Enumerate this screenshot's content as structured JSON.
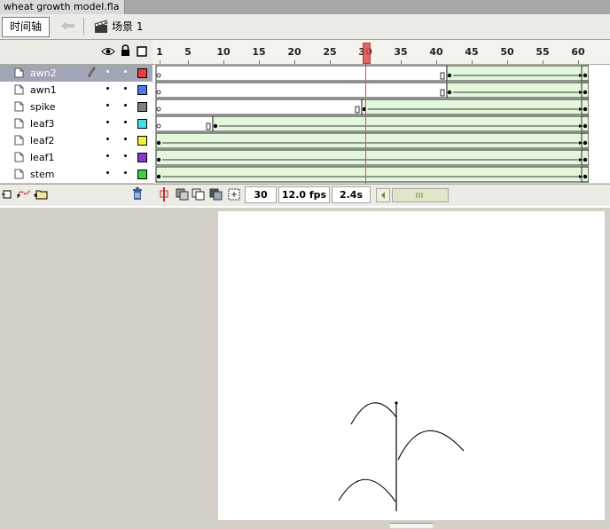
{
  "document": {
    "tab_title": "wheat growth model.fla"
  },
  "toolbar": {
    "timeline_label": "时间轴",
    "scene_label": "场景 1"
  },
  "ruler": {
    "labels": [
      "1",
      "5",
      "10",
      "15",
      "20",
      "25",
      "30",
      "35",
      "40",
      "45",
      "50",
      "55",
      "60"
    ],
    "frames": [
      1,
      5,
      10,
      15,
      20,
      25,
      30,
      35,
      40,
      45,
      50,
      55,
      60
    ],
    "total_frames": 61
  },
  "playhead": {
    "frame": 30
  },
  "layers": [
    {
      "name": "awn2",
      "color": "#e84040",
      "selected": true,
      "keyframes": [
        1,
        41,
        42,
        61
      ],
      "tween_start": 42,
      "tween_end": 61
    },
    {
      "name": "awn1",
      "color": "#4a7ae8",
      "selected": false,
      "keyframes": [
        1,
        41,
        42,
        61
      ],
      "tween_start": 42,
      "tween_end": 61
    },
    {
      "name": "spike",
      "color": "#808080",
      "selected": false,
      "keyframes": [
        1,
        29,
        30,
        61
      ],
      "tween_start": 30,
      "tween_end": 61
    },
    {
      "name": "leaf3",
      "color": "#48e0e8",
      "selected": false,
      "keyframes": [
        1,
        8,
        9,
        61
      ],
      "tween_start": 9,
      "tween_end": 61
    },
    {
      "name": "leaf2",
      "color": "#f0f040",
      "selected": false,
      "keyframes": [
        1,
        61
      ],
      "tween_start": 1,
      "tween_end": 61
    },
    {
      "name": "leaf1",
      "color": "#8a3ad0",
      "selected": false,
      "keyframes": [
        1,
        61
      ],
      "tween_start": 1,
      "tween_end": 61
    },
    {
      "name": "stem",
      "color": "#40d040",
      "selected": false,
      "keyframes": [
        1,
        61
      ],
      "tween_start": 1,
      "tween_end": 61
    }
  ],
  "status": {
    "current_frame": "30",
    "frame_rate": "12.0 fps",
    "elapsed_time": "2.4s"
  },
  "icons": {
    "layer": "layer-page-icon",
    "pencil": "pencil-icon",
    "eye": "eye-icon",
    "lock": "lock-icon",
    "outline": "outline-square-icon",
    "insert_layer": "insert-layer-icon",
    "motion_guide": "add-motion-guide-icon",
    "folder": "insert-folder-icon",
    "trash": "delete-layer-icon",
    "center_frame": "center-frame-icon",
    "onion": "onion-skin-icon",
    "onion_outline": "onion-skin-outline-icon",
    "edit_multiple": "edit-multiple-frames-icon",
    "onion_markers": "modify-onion-markers-icon",
    "back": "back-arrow-icon",
    "scene": "scene-clapper-icon"
  },
  "colors": {
    "tween_fill": "#e2f7dc",
    "playhead": "#e05050",
    "selected_layer": "#a0a6b6"
  }
}
